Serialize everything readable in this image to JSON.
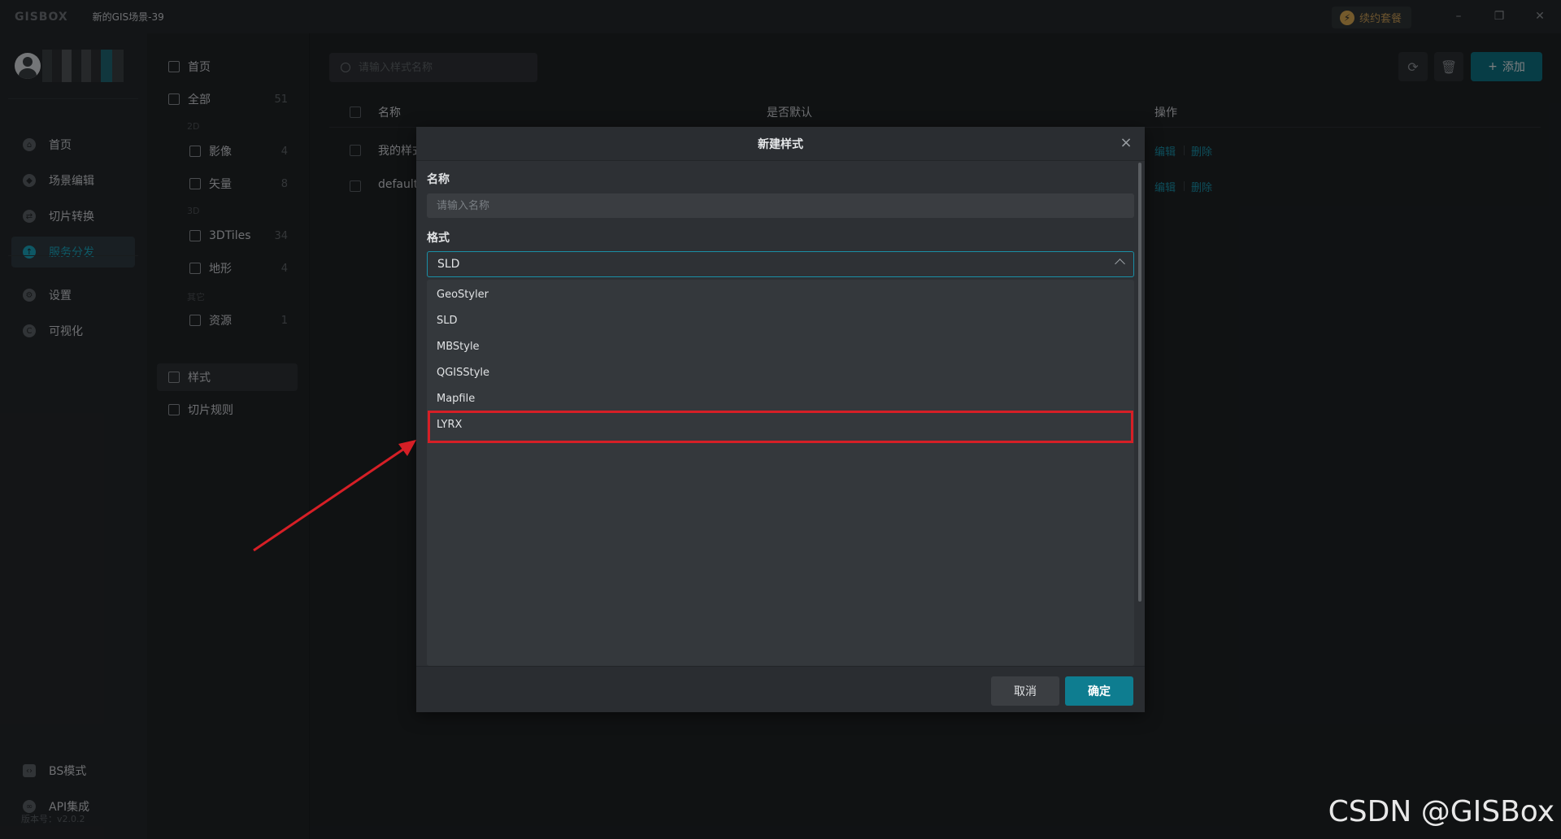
{
  "titlebar": {
    "logo": "GISBOX",
    "title": "新的GIS场景-39",
    "renew_label": "续约套餐",
    "minimize": "–",
    "restore": "❐",
    "close": "✕"
  },
  "leftnav": {
    "items": [
      {
        "label": "首页",
        "icon": "home-icon"
      },
      {
        "label": "场景编辑",
        "icon": "cube-icon"
      },
      {
        "label": "切片转换",
        "icon": "convert-icon"
      },
      {
        "label": "服务分发",
        "icon": "upload-icon"
      },
      {
        "label": "设置",
        "icon": "gear-icon"
      },
      {
        "label": "可视化",
        "icon": "chart-icon"
      },
      {
        "label": "BS模式",
        "icon": "code-icon"
      },
      {
        "label": "API集成",
        "icon": "link-icon"
      }
    ],
    "active": "服务分发",
    "version": "版本号：v2.0.2"
  },
  "catpanel": {
    "home": "首页",
    "all": {
      "label": "全部",
      "count": "51"
    },
    "group_2d": "2D",
    "imagery": {
      "label": "影像",
      "count": "4"
    },
    "vector": {
      "label": "矢量",
      "count": "8"
    },
    "group_3d": "3D",
    "tiles3d": {
      "label": "3DTiles",
      "count": "34"
    },
    "terrain": {
      "label": "地形",
      "count": "4"
    },
    "group_other": "其它",
    "resource": {
      "label": "资源",
      "count": "1"
    },
    "style": "样式",
    "tile_rules": "切片规则"
  },
  "main": {
    "search_placeholder": "请输入样式名称",
    "add_label": "添加",
    "columns": {
      "name": "名称",
      "is_default": "是否默认",
      "actions": "操作"
    },
    "rows": [
      {
        "name": "我的样式",
        "edit": "编辑",
        "delete": "删除"
      },
      {
        "name": "default",
        "edit": "编辑",
        "delete": "删除"
      }
    ]
  },
  "dialog": {
    "title": "新建样式",
    "name_label": "名称",
    "name_placeholder": "请输入名称",
    "format_label": "格式",
    "format_value": "SLD",
    "options": [
      "GeoStyler",
      "SLD",
      "MBStyle",
      "QGISStyle",
      "Mapfile",
      "LYRX"
    ],
    "highlighted_option": "LYRX",
    "cancel": "取消",
    "ok": "确定"
  },
  "watermark": "CSDN @GISBox",
  "colors": {
    "accent": "#1aa0b8",
    "primary_button": "#0e7d90",
    "highlight_box": "#d61f26"
  }
}
